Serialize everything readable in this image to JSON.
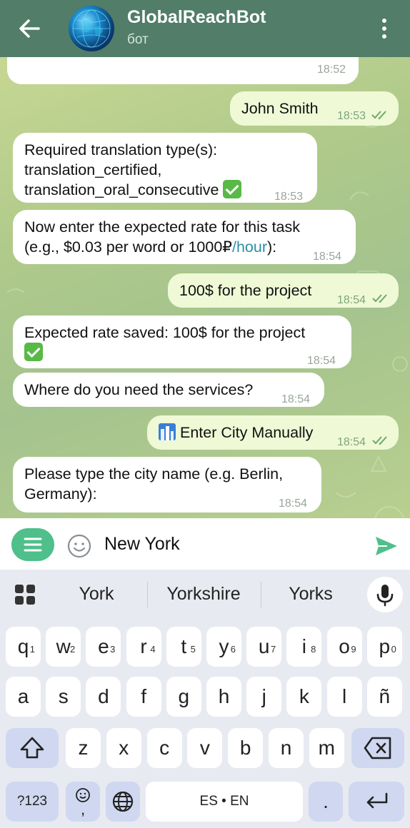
{
  "header": {
    "title": "GlobalReachBot",
    "subtitle": "бот"
  },
  "messages": [
    {
      "dir": "in",
      "lines": [
        "",
        ""
      ],
      "time": "18:52"
    },
    {
      "dir": "out",
      "text": "John Smith",
      "time": "18:53"
    },
    {
      "dir": "in",
      "lines": [
        "Required translation type(s):",
        "translation_certified,",
        "translation_oral_consecutive"
      ],
      "time": "18:53"
    },
    {
      "dir": "in",
      "lines": [
        "Now enter the expected rate for this task",
        "(e.g., $0.03 per word or 1000₽"
      ],
      "link": "/hour",
      "tail": "):",
      "time": "18:54"
    },
    {
      "dir": "out",
      "text": "100$ for the project",
      "time": "18:54"
    },
    {
      "dir": "in",
      "lines": [
        "Expected rate saved: 100$ for the project"
      ],
      "time": "18:54"
    },
    {
      "dir": "in",
      "lines": [
        "Where do you need the services?"
      ],
      "time": "18:54"
    },
    {
      "dir": "out",
      "text": "Enter City Manually",
      "time": "18:54"
    },
    {
      "dir": "in",
      "lines": [
        "Please type the city name (e.g. Berlin,",
        "Germany):"
      ],
      "time": "18:54"
    }
  ],
  "input": {
    "value": "New York"
  },
  "keyboard": {
    "suggestions": [
      "York",
      "Yorkshire",
      "Yorks"
    ],
    "row1": [
      {
        "k": "q",
        "n": "1"
      },
      {
        "k": "w",
        "n": "2"
      },
      {
        "k": "e",
        "n": "3"
      },
      {
        "k": "r",
        "n": "4"
      },
      {
        "k": "t",
        "n": "5"
      },
      {
        "k": "y",
        "n": "6"
      },
      {
        "k": "u",
        "n": "7"
      },
      {
        "k": "i",
        "n": "8"
      },
      {
        "k": "o",
        "n": "9"
      },
      {
        "k": "p",
        "n": "0"
      }
    ],
    "row2": [
      "a",
      "s",
      "d",
      "f",
      "g",
      "h",
      "j",
      "k",
      "l",
      "ñ"
    ],
    "row3": [
      "z",
      "x",
      "c",
      "v",
      "b",
      "n",
      "m"
    ],
    "symbols_label": "?123",
    "emoji_label": ",",
    "space_label": "ES • EN",
    "period_label": "."
  },
  "colors": {
    "header": "#517d69",
    "outgoing_bubble": "#eff9d6",
    "incoming_bubble": "#ffffff",
    "accent": "#4fbf8b",
    "link": "#2c8fa6"
  },
  "icons": [
    "back-arrow-icon",
    "more-vert-icon",
    "menu-icon",
    "smile-icon",
    "send-icon",
    "apps-grid-icon",
    "mic-icon",
    "shift-icon",
    "backspace-icon",
    "globe-icon",
    "enter-icon",
    "check-emoji-icon",
    "city-emoji-icon",
    "double-check-icon"
  ]
}
